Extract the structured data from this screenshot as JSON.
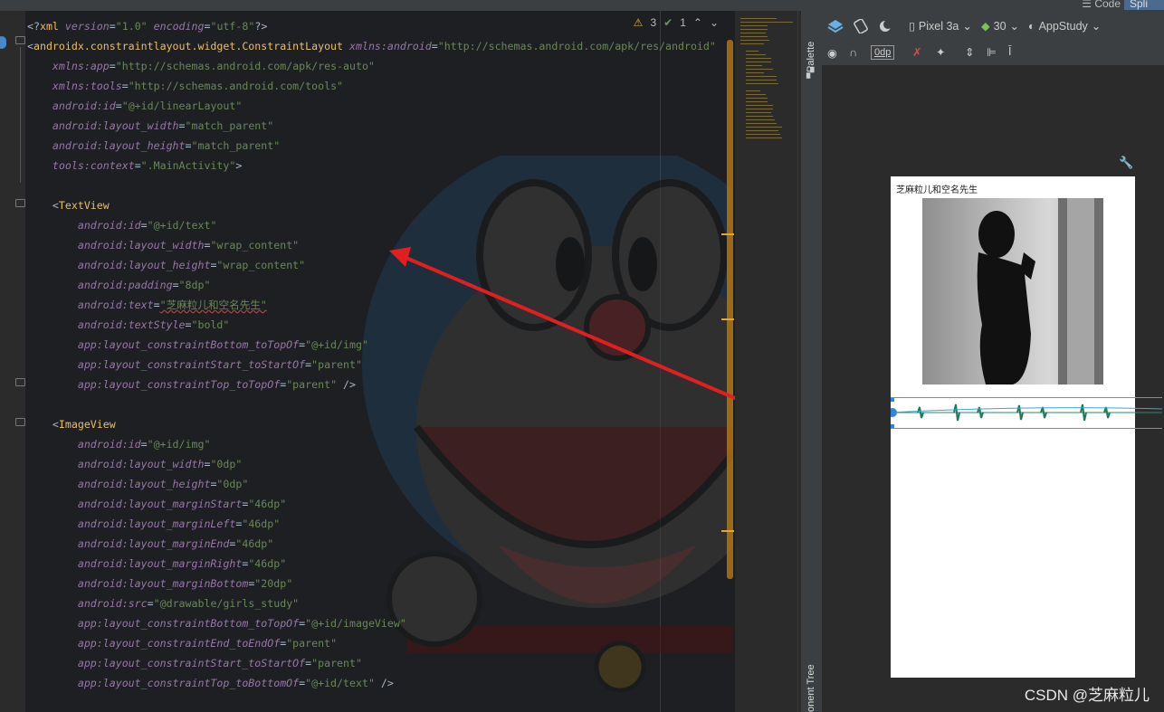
{
  "topbar": {
    "code_label": "Code",
    "split_label": "Spli"
  },
  "editor": {
    "warnings_count": "3",
    "checks_count": "1",
    "lines": [
      [
        [
          "punct",
          "<?"
        ],
        [
          "tag",
          "xml "
        ],
        [
          "attr",
          "version"
        ],
        [
          "punct",
          "="
        ],
        [
          "val",
          "\"1.0\" "
        ],
        [
          "attr",
          "encoding"
        ],
        [
          "punct",
          "="
        ],
        [
          "val",
          "\"utf-8\""
        ],
        [
          "punct",
          "?>"
        ]
      ],
      [
        [
          "punct",
          "<"
        ],
        [
          "tag",
          "androidx.constraintlayout.widget.ConstraintLayout "
        ],
        [
          "ns",
          "xmlns:"
        ],
        [
          "attr",
          "android"
        ],
        [
          "punct",
          "="
        ],
        [
          "val",
          "\"http://schemas.android.com/apk/res/android\""
        ]
      ],
      [
        [
          "punct",
          "    "
        ],
        [
          "ns",
          "xmlns:"
        ],
        [
          "attr",
          "app"
        ],
        [
          "punct",
          "="
        ],
        [
          "val",
          "\"http://schemas.android.com/apk/res-auto\""
        ]
      ],
      [
        [
          "punct",
          "    "
        ],
        [
          "ns",
          "xmlns:"
        ],
        [
          "attr",
          "tools"
        ],
        [
          "punct",
          "="
        ],
        [
          "val",
          "\"http://schemas.android.com/tools\""
        ]
      ],
      [
        [
          "punct",
          "    "
        ],
        [
          "ns",
          "android:"
        ],
        [
          "attr",
          "id"
        ],
        [
          "punct",
          "="
        ],
        [
          "val",
          "\"@+id/linearLayout\""
        ]
      ],
      [
        [
          "punct",
          "    "
        ],
        [
          "ns",
          "android:"
        ],
        [
          "attr",
          "layout_width"
        ],
        [
          "punct",
          "="
        ],
        [
          "val",
          "\"match_parent\""
        ]
      ],
      [
        [
          "punct",
          "    "
        ],
        [
          "ns",
          "android:"
        ],
        [
          "attr",
          "layout_height"
        ],
        [
          "punct",
          "="
        ],
        [
          "val",
          "\"match_parent\""
        ]
      ],
      [
        [
          "punct",
          "    "
        ],
        [
          "ns",
          "tools:"
        ],
        [
          "attr",
          "context"
        ],
        [
          "punct",
          "="
        ],
        [
          "val",
          "\".MainActivity\""
        ],
        [
          "punct",
          ">"
        ]
      ],
      [
        [
          "punct",
          ""
        ]
      ],
      [
        [
          "punct",
          "    <"
        ],
        [
          "tag",
          "TextView"
        ]
      ],
      [
        [
          "punct",
          "        "
        ],
        [
          "ns",
          "android:"
        ],
        [
          "attr",
          "id"
        ],
        [
          "punct",
          "="
        ],
        [
          "val",
          "\"@+id/text\""
        ]
      ],
      [
        [
          "punct",
          "        "
        ],
        [
          "ns",
          "android:"
        ],
        [
          "attr",
          "layout_width"
        ],
        [
          "punct",
          "="
        ],
        [
          "val",
          "\"wrap_content\""
        ]
      ],
      [
        [
          "punct",
          "        "
        ],
        [
          "ns",
          "android:"
        ],
        [
          "attr",
          "layout_height"
        ],
        [
          "punct",
          "="
        ],
        [
          "val",
          "\"wrap_content\""
        ]
      ],
      [
        [
          "punct",
          "        "
        ],
        [
          "ns",
          "android:"
        ],
        [
          "attr",
          "padding"
        ],
        [
          "punct",
          "="
        ],
        [
          "val",
          "\"8dp\""
        ]
      ],
      [
        [
          "punct",
          "        "
        ],
        [
          "ns",
          "android:"
        ],
        [
          "attr",
          "text"
        ],
        [
          "punct",
          "="
        ],
        [
          "val",
          "\"芝麻粒儿和空名先生\""
        ]
      ],
      [
        [
          "punct",
          "        "
        ],
        [
          "ns",
          "android:"
        ],
        [
          "attr",
          "textStyle"
        ],
        [
          "punct",
          "="
        ],
        [
          "val",
          "\"bold\""
        ]
      ],
      [
        [
          "punct",
          "        "
        ],
        [
          "ns",
          "app:"
        ],
        [
          "attr",
          "layout_constraintBottom_toTopOf"
        ],
        [
          "punct",
          "="
        ],
        [
          "val",
          "\"@+id/img\""
        ]
      ],
      [
        [
          "punct",
          "        "
        ],
        [
          "ns",
          "app:"
        ],
        [
          "attr",
          "layout_constraintStart_toStartOf"
        ],
        [
          "punct",
          "="
        ],
        [
          "val",
          "\"parent\""
        ]
      ],
      [
        [
          "punct",
          "        "
        ],
        [
          "ns",
          "app:"
        ],
        [
          "attr",
          "layout_constraintTop_toTopOf"
        ],
        [
          "punct",
          "="
        ],
        [
          "val",
          "\"parent\" "
        ],
        [
          "punct",
          "/>"
        ]
      ],
      [
        [
          "punct",
          ""
        ]
      ],
      [
        [
          "punct",
          "    <"
        ],
        [
          "tag",
          "ImageView"
        ]
      ],
      [
        [
          "punct",
          "        "
        ],
        [
          "ns",
          "android:"
        ],
        [
          "attr",
          "id"
        ],
        [
          "punct",
          "="
        ],
        [
          "val",
          "\"@+id/img\""
        ]
      ],
      [
        [
          "punct",
          "        "
        ],
        [
          "ns",
          "android:"
        ],
        [
          "attr",
          "layout_width"
        ],
        [
          "punct",
          "="
        ],
        [
          "val",
          "\"0dp\""
        ]
      ],
      [
        [
          "punct",
          "        "
        ],
        [
          "ns",
          "android:"
        ],
        [
          "attr",
          "layout_height"
        ],
        [
          "punct",
          "="
        ],
        [
          "val",
          "\"0dp\""
        ]
      ],
      [
        [
          "punct",
          "        "
        ],
        [
          "ns",
          "android:"
        ],
        [
          "attr",
          "layout_marginStart"
        ],
        [
          "punct",
          "="
        ],
        [
          "val",
          "\"46dp\""
        ]
      ],
      [
        [
          "punct",
          "        "
        ],
        [
          "ns",
          "android:"
        ],
        [
          "attr",
          "layout_marginLeft"
        ],
        [
          "punct",
          "="
        ],
        [
          "val",
          "\"46dp\""
        ]
      ],
      [
        [
          "punct",
          "        "
        ],
        [
          "ns",
          "android:"
        ],
        [
          "attr",
          "layout_marginEnd"
        ],
        [
          "punct",
          "="
        ],
        [
          "val",
          "\"46dp\""
        ]
      ],
      [
        [
          "punct",
          "        "
        ],
        [
          "ns",
          "android:"
        ],
        [
          "attr",
          "layout_marginRight"
        ],
        [
          "punct",
          "="
        ],
        [
          "val",
          "\"46dp\""
        ]
      ],
      [
        [
          "punct",
          "        "
        ],
        [
          "ns",
          "android:"
        ],
        [
          "attr",
          "layout_marginBottom"
        ],
        [
          "punct",
          "="
        ],
        [
          "val",
          "\"20dp\""
        ]
      ],
      [
        [
          "punct",
          "        "
        ],
        [
          "ns",
          "android:"
        ],
        [
          "attr",
          "src"
        ],
        [
          "punct",
          "="
        ],
        [
          "val",
          "\"@drawable/girls_study\""
        ]
      ],
      [
        [
          "punct",
          "        "
        ],
        [
          "ns",
          "app:"
        ],
        [
          "attr",
          "layout_constraintBottom_toTopOf"
        ],
        [
          "punct",
          "="
        ],
        [
          "val",
          "\"@+id/imageView\""
        ]
      ],
      [
        [
          "punct",
          "        "
        ],
        [
          "ns",
          "app:"
        ],
        [
          "attr",
          "layout_constraintEnd_toEndOf"
        ],
        [
          "punct",
          "="
        ],
        [
          "val",
          "\"parent\""
        ]
      ],
      [
        [
          "punct",
          "        "
        ],
        [
          "ns",
          "app:"
        ],
        [
          "attr",
          "layout_constraintStart_toStartOf"
        ],
        [
          "punct",
          "="
        ],
        [
          "val",
          "\"parent\""
        ]
      ],
      [
        [
          "punct",
          "        "
        ],
        [
          "ns",
          "app:"
        ],
        [
          "attr",
          "layout_constraintTop_toBottomOf"
        ],
        [
          "punct",
          "="
        ],
        [
          "val",
          "\"@+id/text\" "
        ],
        [
          "punct",
          "/>"
        ]
      ]
    ]
  },
  "side_tabs": {
    "palette": "Palette",
    "component_tree": "onent Tree"
  },
  "design_toolbar": {
    "device": "Pixel 3a",
    "api_level": "30",
    "theme": "AppStudy",
    "margin_value": "0dp"
  },
  "preview": {
    "title_text": "芝麻粒儿和空名先生"
  },
  "watermark": "CSDN @芝麻粒儿"
}
